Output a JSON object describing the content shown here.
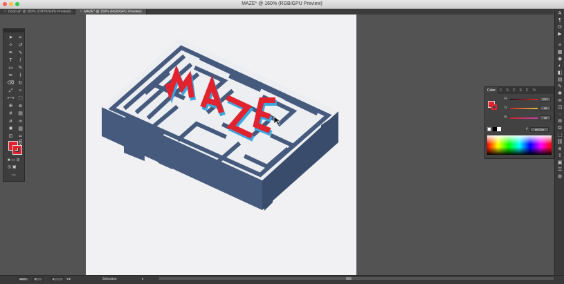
{
  "window": {
    "title": "MAZE* @ 160% (RGB/GPU Preview)",
    "traffic_lights": [
      "#fc605c",
      "#fdbc40",
      "#34c84a"
    ]
  },
  "tabs": [
    {
      "label": "Dodo.ai* @ 300% (CMYK/GPU Preview)",
      "active": false
    },
    {
      "label": "MAZE* @ 150% (RGB/GPU Preview)",
      "active": true
    }
  ],
  "artwork": {
    "maze_top_color": "#eceef2",
    "maze_side_color": "#455a7d",
    "letters_color": "#e0232e",
    "letters_side_color": "#3aa7e0"
  },
  "tools": {
    "icons": [
      "selection-icon",
      "direct-selection-icon",
      "magic-wand-icon",
      "lasso-icon",
      "pen-icon",
      "curvature-icon",
      "type-icon",
      "line-icon",
      "rectangle-icon",
      "paintbrush-icon",
      "pencil-icon",
      "shaper-icon",
      "eraser-icon",
      "rotate-icon",
      "scale-icon",
      "warp-icon",
      "width-icon",
      "free-transform-icon",
      "shape-builder-icon",
      "perspective-icon",
      "mesh-icon",
      "gradient-icon",
      "eyedropper-icon",
      "blend-icon",
      "symbol-sprayer-icon",
      "graph-icon",
      "artboard-icon",
      "slice-icon",
      "hand-icon",
      "zoom-icon"
    ],
    "fill_color": "#e0232e",
    "stroke_color": "#e0232e"
  },
  "color_panel": {
    "tabs": [
      "Color",
      "C",
      "S",
      "C",
      "S",
      "C",
      "Tr"
    ],
    "fill_chip": "#e0232e",
    "sliders": [
      {
        "label": "R",
        "value": "227",
        "track": "#e0232e"
      },
      {
        "label": "G",
        "value": "35",
        "track": "#d8c23a"
      },
      {
        "label": "B",
        "value": "46",
        "track": "#c83fa8"
      }
    ],
    "hex_label": "#",
    "hex": "e0232e"
  },
  "status": {
    "zoom": "150%",
    "rotation": "0°",
    "page": "1",
    "tool_label": "Selection"
  }
}
